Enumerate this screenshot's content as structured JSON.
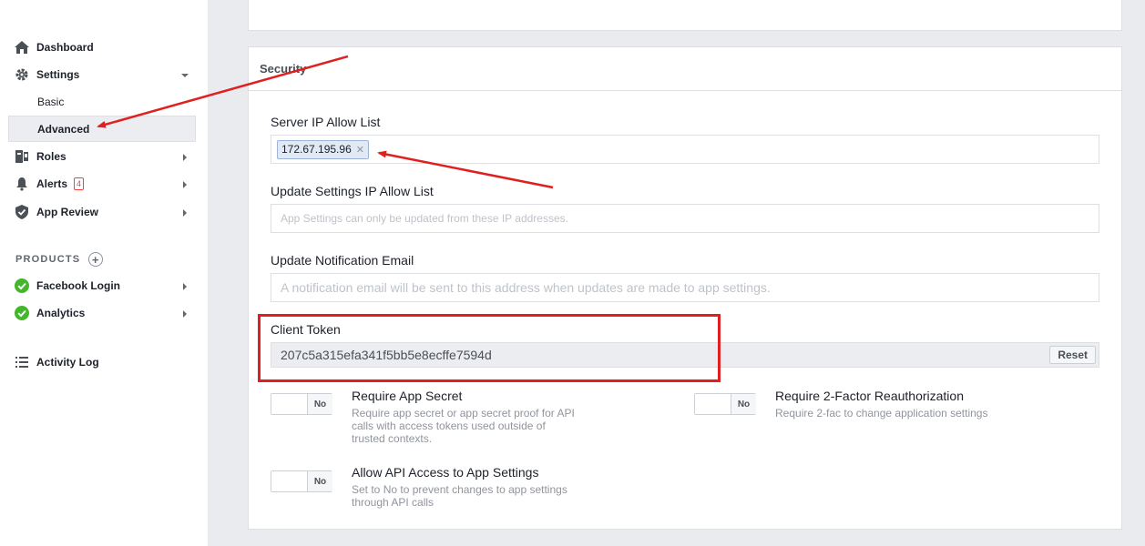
{
  "sidebar": {
    "dashboard": "Dashboard",
    "settings": "Settings",
    "basic": "Basic",
    "advanced": "Advanced",
    "roles": "Roles",
    "alerts": "Alerts",
    "alerts_badge": "4",
    "app_review": "App Review",
    "products_label": "PRODUCTS",
    "facebook_login": "Facebook Login",
    "analytics": "Analytics",
    "activity_log": "Activity Log"
  },
  "security": {
    "title": "Security",
    "server_ip_label": "Server IP Allow List",
    "server_ip_tag": "172.67.195.96",
    "update_ip_label": "Update Settings IP Allow List",
    "update_ip_placeholder": "App Settings can only be updated from these IP addresses.",
    "notification_email_label": "Update Notification Email",
    "notification_email_placeholder": "A notification email will be sent to this address when updates are made to app settings.",
    "client_token_label": "Client Token",
    "client_token_value": "207c5a315efa341f5bb5e8ecffe7594d",
    "reset_label": "Reset",
    "require_secret_title": "Require App Secret",
    "require_secret_desc": "Require app secret or app secret proof for API calls with access tokens used outside of trusted contexts.",
    "require_secret_value": "No",
    "require_2fa_title": "Require 2-Factor Reauthorization",
    "require_2fa_desc": "Require 2-fac to change application settings",
    "require_2fa_value": "No",
    "allow_api_title": "Allow API Access to App Settings",
    "allow_api_desc": "Set to No to prevent changes to app settings through API calls",
    "allow_api_value": "No"
  },
  "colors": {
    "annotation_red": "#e02020",
    "check_green": "#42b72a"
  }
}
